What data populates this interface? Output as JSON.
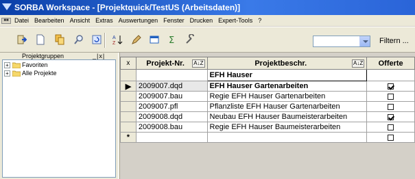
{
  "window": {
    "title": "SORBA Workspace - [Projektquick/TestUS (Arbeitsdaten)]"
  },
  "menu": {
    "mdi_icon": "mdi-child-icon",
    "items": [
      "Datei",
      "Bearbeiten",
      "Ansicht",
      "Extras",
      "Auswertungen",
      "Fenster",
      "Drucken",
      "Expert-Tools",
      "?"
    ]
  },
  "toolbar": {
    "icons": [
      "exit-icon",
      "new-doc-icon",
      "copy-icon",
      "search-icon",
      "refresh-icon",
      "sort-az-icon",
      "edit-icon",
      "window-icon",
      "sum-icon",
      "tools-icon"
    ],
    "filter_label": "Filtern ...",
    "filter_value": ""
  },
  "sidebar": {
    "header": "Projektgruppen",
    "header_buttons": "_|x|",
    "nodes": [
      {
        "label": "Favoriten",
        "expander": "+"
      },
      {
        "label": "Alle Projekte",
        "expander": "+"
      }
    ]
  },
  "grid": {
    "corner": "x",
    "columns": {
      "projekt_nr": "Projekt-Nr.",
      "beschr": "Projektbeschr.",
      "offerte": "Offerte"
    },
    "sort_icon": "A↓Z",
    "filter_beschr": "EFH Hauser",
    "rows": [
      {
        "indicator": "▶",
        "nr": "2009007.dqd",
        "beschr": "EFH Hauser Gartenarbeiten",
        "offerte": true,
        "bold": true,
        "selected": true
      },
      {
        "indicator": "",
        "nr": "2009007.bau",
        "beschr": "Regie EFH Hauser Gartenarbeiten",
        "offerte": false
      },
      {
        "indicator": "",
        "nr": "2009007.pfl",
        "beschr": "Pflanzliste EFH Hauser Gartenarbeiten",
        "offerte": false
      },
      {
        "indicator": "",
        "nr": "2009008.dqd",
        "beschr": "Neubau EFH Hauser Baumeisterarbeiten",
        "offerte": true
      },
      {
        "indicator": "",
        "nr": "2009008.bau",
        "beschr": "Regie EFH Hauser Baumeisterarbeiten",
        "offerte": false
      }
    ],
    "new_row_indicator": "*"
  }
}
